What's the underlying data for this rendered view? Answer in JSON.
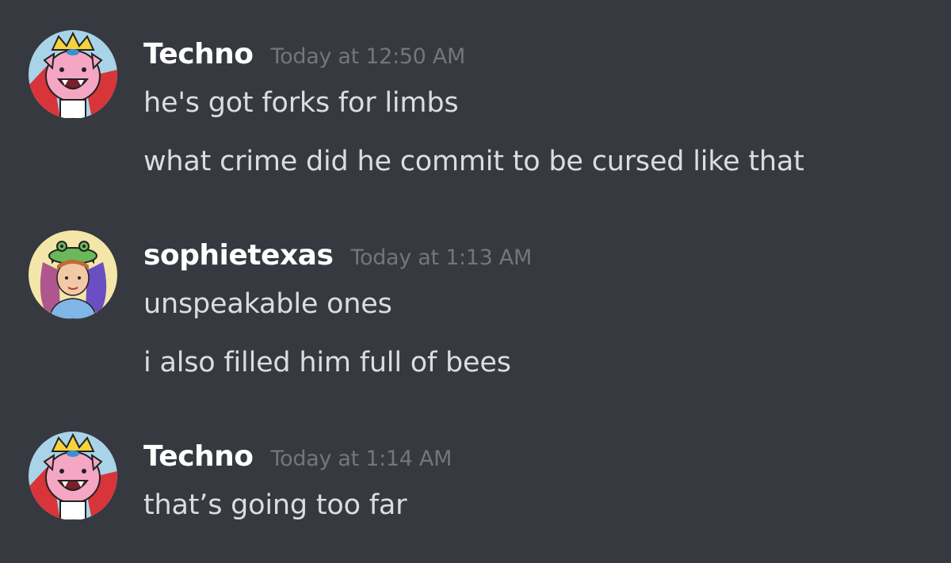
{
  "colors": {
    "background": "#36393f",
    "username": "#ffffff",
    "timestamp": "#72767d",
    "message_text": "#dcddde"
  },
  "messages": [
    {
      "avatar": "pig-king-avatar",
      "username": "Techno",
      "timestamp": "Today at 12:50 AM",
      "lines": [
        "he's got forks for limbs",
        "what crime did he commit to be cursed like that"
      ]
    },
    {
      "avatar": "girl-frog-hat-avatar",
      "username": "sophietexas",
      "timestamp": "Today at 1:13 AM",
      "lines": [
        "unspeakable ones",
        "i also filled him full of bees"
      ]
    },
    {
      "avatar": "pig-king-avatar",
      "username": "Techno",
      "timestamp": "Today at 1:14 AM",
      "lines": [
        "that’s going too far"
      ]
    }
  ]
}
